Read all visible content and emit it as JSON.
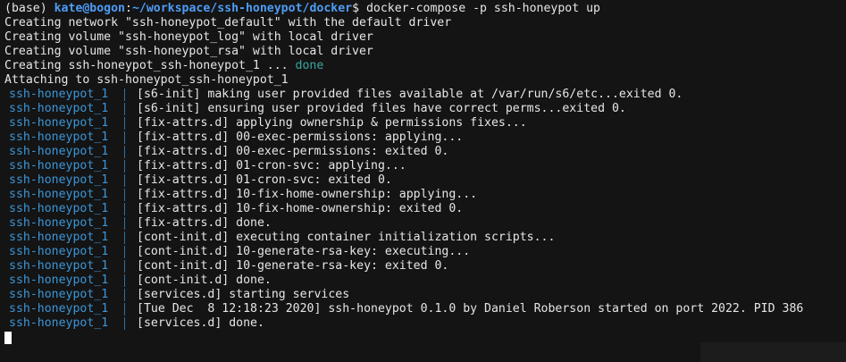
{
  "prompt": {
    "env": "(base)",
    "user_host": "kate@bogon",
    "separator": ":",
    "path": "~/workspace/ssh-honeypot/docker",
    "dollar": "$",
    "command": " docker-compose -p ssh-honeypot up"
  },
  "setup_lines": [
    "Creating network \"ssh-honeypot_default\" with the default driver",
    "Creating volume \"ssh-honeypot_log\" with local driver",
    "Creating volume \"ssh-honeypot_rsa\" with local driver"
  ],
  "creating_container": {
    "text": "Creating ssh-honeypot_ssh-honeypot_1 ... ",
    "status": "done"
  },
  "attaching_line": "Attaching to ssh-honeypot_ssh-honeypot_1",
  "log_service": "ssh-honeypot_1",
  "log_lines": [
    "[s6-init] making user provided files available at /var/run/s6/etc...exited 0.",
    "[s6-init] ensuring user provided files have correct perms...exited 0.",
    "[fix-attrs.d] applying ownership & permissions fixes...",
    "[fix-attrs.d] 00-exec-permissions: applying...",
    "[fix-attrs.d] 00-exec-permissions: exited 0.",
    "[fix-attrs.d] 01-cron-svc: applying...",
    "[fix-attrs.d] 01-cron-svc: exited 0.",
    "[fix-attrs.d] 10-fix-home-ownership: applying...",
    "[fix-attrs.d] 10-fix-home-ownership: exited 0.",
    "[fix-attrs.d] done.",
    "[cont-init.d] executing container initialization scripts...",
    "[cont-init.d] 10-generate-rsa-key: executing...",
    "[cont-init.d] 10-generate-rsa-key: exited 0.",
    "[cont-init.d] done.",
    "[services.d] starting services",
    "[Tue Dec  8 12:18:23 2020] ssh-honeypot 0.1.0 by Daniel Roberson started on port 2022. PID 386",
    "[services.d] done."
  ],
  "colors": {
    "background": "#141414",
    "text": "#e6e6e6",
    "prompt_blue": "#4d9df5",
    "service_blue": "#3b96d8",
    "done_teal": "#3aa7a0"
  }
}
